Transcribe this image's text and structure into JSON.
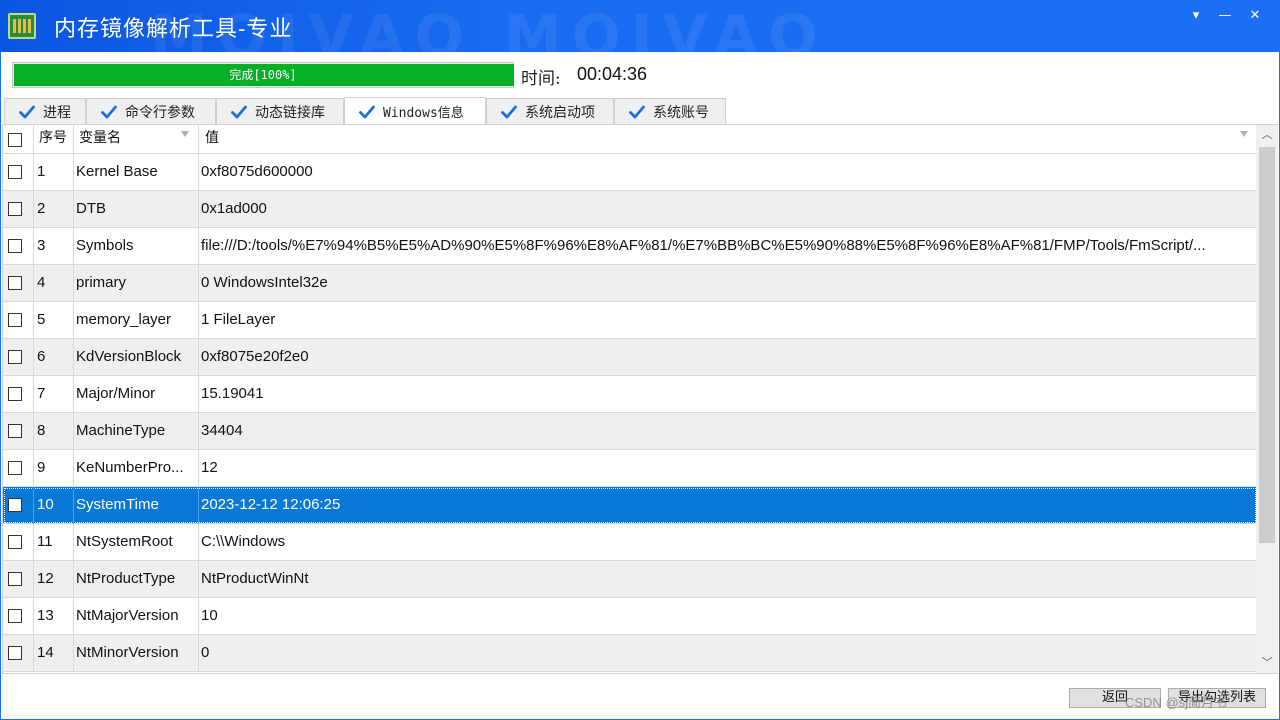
{
  "window": {
    "title": "内存镜像解析工具-专业",
    "watermark_text": "MOIVAO  MOIVAO",
    "controls": {
      "menu": "▾",
      "minimize": "—",
      "close": "✕"
    }
  },
  "progress": {
    "label": "完成[100%]",
    "percent": 100,
    "color": "#06b025"
  },
  "timer": {
    "label": "时间:",
    "value": "00:04:36"
  },
  "tabs": [
    {
      "label": "进程",
      "active": false
    },
    {
      "label": "命令行参数",
      "active": false
    },
    {
      "label": "动态链接库",
      "active": false
    },
    {
      "label": "Windows信息",
      "active": true
    },
    {
      "label": "系统启动项",
      "active": false
    },
    {
      "label": "系统账号",
      "active": false
    }
  ],
  "table": {
    "headers": {
      "index": "序号",
      "name": "变量名",
      "value": "值"
    },
    "rows": [
      {
        "index": "1",
        "name": "Kernel Base",
        "value": "0xf8075d600000"
      },
      {
        "index": "2",
        "name": "DTB",
        "value": "0x1ad000"
      },
      {
        "index": "3",
        "name": "Symbols",
        "value": "file:///D:/tools/%E7%94%B5%E5%AD%90%E5%8F%96%E8%AF%81/%E7%BB%BC%E5%90%88%E5%8F%96%E8%AF%81/FMP/Tools/FmScript/..."
      },
      {
        "index": "4",
        "name": "primary",
        "value": "0 WindowsIntel32e"
      },
      {
        "index": "5",
        "name": "memory_layer",
        "value": "1 FileLayer"
      },
      {
        "index": "6",
        "name": "KdVersionBlock",
        "value": "0xf8075e20f2e0"
      },
      {
        "index": "7",
        "name": "Major/Minor",
        "value": "15.19041"
      },
      {
        "index": "8",
        "name": "MachineType",
        "value": "34404"
      },
      {
        "index": "9",
        "name": "KeNumberPro...",
        "value": "12"
      },
      {
        "index": "10",
        "name": "SystemTime",
        "value": "2023-12-12 12:06:25",
        "selected": true
      },
      {
        "index": "11",
        "name": "NtSystemRoot",
        "value": "C:\\\\Windows"
      },
      {
        "index": "12",
        "name": "NtProductType",
        "value": "NtProductWinNt"
      },
      {
        "index": "13",
        "name": "NtMajorVersion",
        "value": "10"
      },
      {
        "index": "14",
        "name": "NtMinorVersion",
        "value": "0"
      }
    ]
  },
  "footer": {
    "back_label": "返回",
    "export_label": "导出勾选列表",
    "watermark": "CSDN @sj简月书"
  },
  "colors": {
    "titlebar": "#1b70f5",
    "selection": "#0a78d7",
    "alt_row": "#efefef"
  }
}
